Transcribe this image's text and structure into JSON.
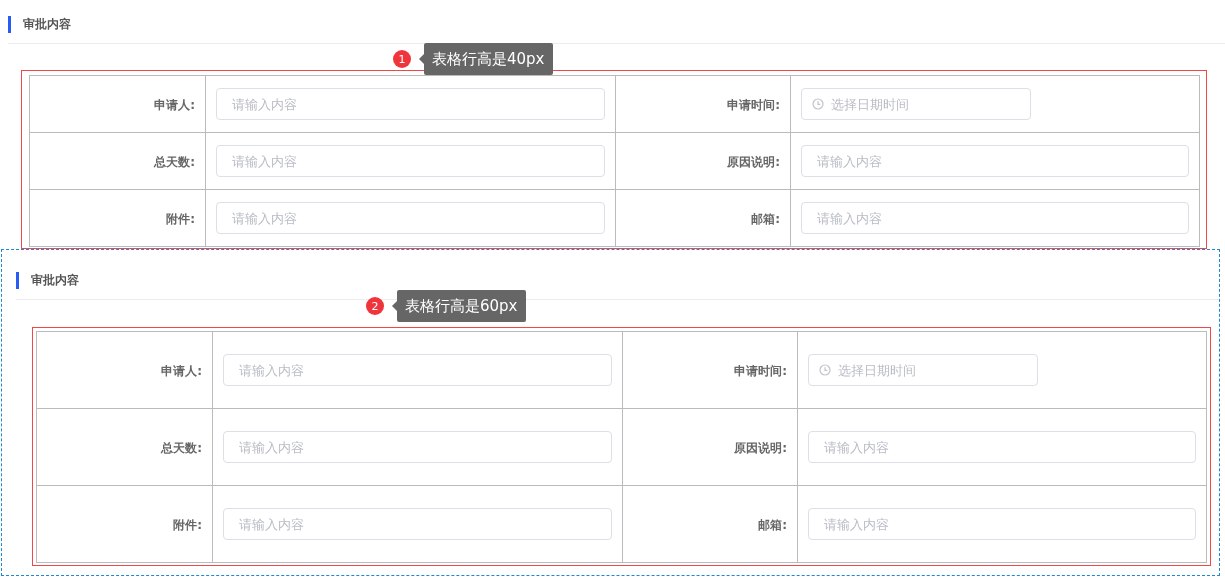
{
  "sections": [
    {
      "title": "审批内容",
      "selected": false,
      "annotation": {
        "number": "1",
        "text": "表格行高是40px"
      },
      "rows": [
        {
          "fields": [
            {
              "label": "申请人:",
              "kind": "text",
              "placeholder": "请输入内容"
            },
            {
              "label": "申请时间:",
              "kind": "datetime",
              "placeholder": "选择日期时间"
            }
          ]
        },
        {
          "fields": [
            {
              "label": "总天数:",
              "kind": "text",
              "placeholder": "请输入内容"
            },
            {
              "label": "原因说明:",
              "kind": "text",
              "placeholder": "请输入内容"
            }
          ]
        },
        {
          "fields": [
            {
              "label": "附件:",
              "kind": "text",
              "placeholder": "请输入内容"
            },
            {
              "label": "邮箱:",
              "kind": "text",
              "placeholder": "请输入内容"
            }
          ]
        }
      ]
    },
    {
      "title": "审批内容",
      "selected": true,
      "annotation": {
        "number": "2",
        "text": "表格行高是60px"
      },
      "rows": [
        {
          "fields": [
            {
              "label": "申请人:",
              "kind": "text",
              "placeholder": "请输入内容"
            },
            {
              "label": "申请时间:",
              "kind": "datetime",
              "placeholder": "选择日期时间"
            }
          ]
        },
        {
          "fields": [
            {
              "label": "总天数:",
              "kind": "text",
              "placeholder": "请输入内容"
            },
            {
              "label": "原因说明:",
              "kind": "text",
              "placeholder": "请输入内容"
            }
          ]
        },
        {
          "fields": [
            {
              "label": "附件:",
              "kind": "text",
              "placeholder": "请输入内容"
            },
            {
              "label": "邮箱:",
              "kind": "text",
              "placeholder": "请输入内容"
            }
          ]
        }
      ]
    }
  ]
}
